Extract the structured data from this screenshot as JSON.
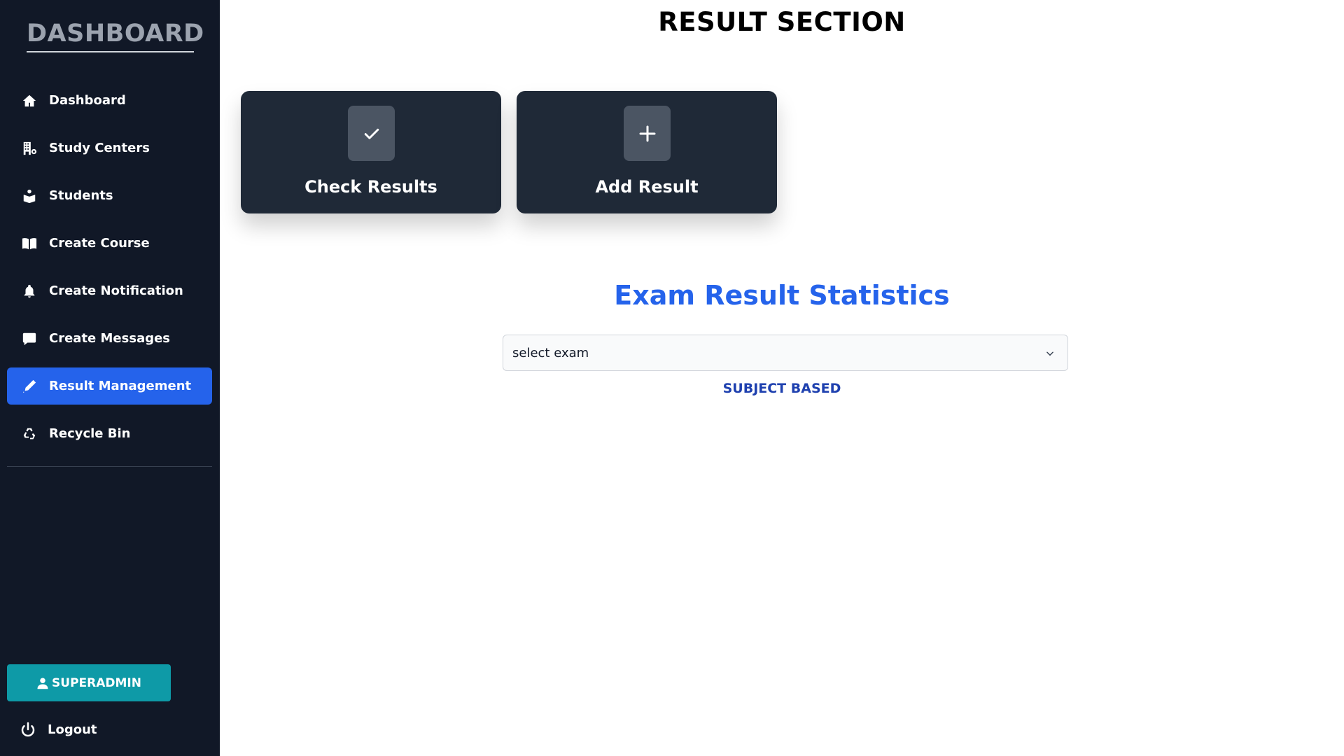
{
  "sidebar": {
    "brand": "DASHBOARD",
    "items": [
      {
        "label": "Dashboard",
        "icon": "home-icon"
      },
      {
        "label": "Study Centers",
        "icon": "building-icon"
      },
      {
        "label": "Students",
        "icon": "students-icon"
      },
      {
        "label": "Create Course",
        "icon": "book-icon"
      },
      {
        "label": "Create Notification",
        "icon": "bell-icon"
      },
      {
        "label": "Create Messages",
        "icon": "message-icon"
      },
      {
        "label": "Result Management",
        "icon": "pen-icon",
        "active": true
      },
      {
        "label": "Recycle Bin",
        "icon": "recycle-icon"
      }
    ],
    "user_button": "SUPERADMIN",
    "logout": "Logout"
  },
  "main": {
    "title": "RESULT SECTION",
    "cards": [
      {
        "label": "Check Results",
        "icon": "check-icon"
      },
      {
        "label": "Add Result",
        "icon": "plus-icon"
      }
    ],
    "stats_title": "Exam Result Statistics",
    "exam_select": {
      "value": "select exam"
    },
    "subject_based": "SUBJECT BASED"
  },
  "colors": {
    "sidebar_bg": "#111827",
    "accent": "#2563eb",
    "card_bg": "#1f2937",
    "admin_button": "#0e9aa7"
  }
}
